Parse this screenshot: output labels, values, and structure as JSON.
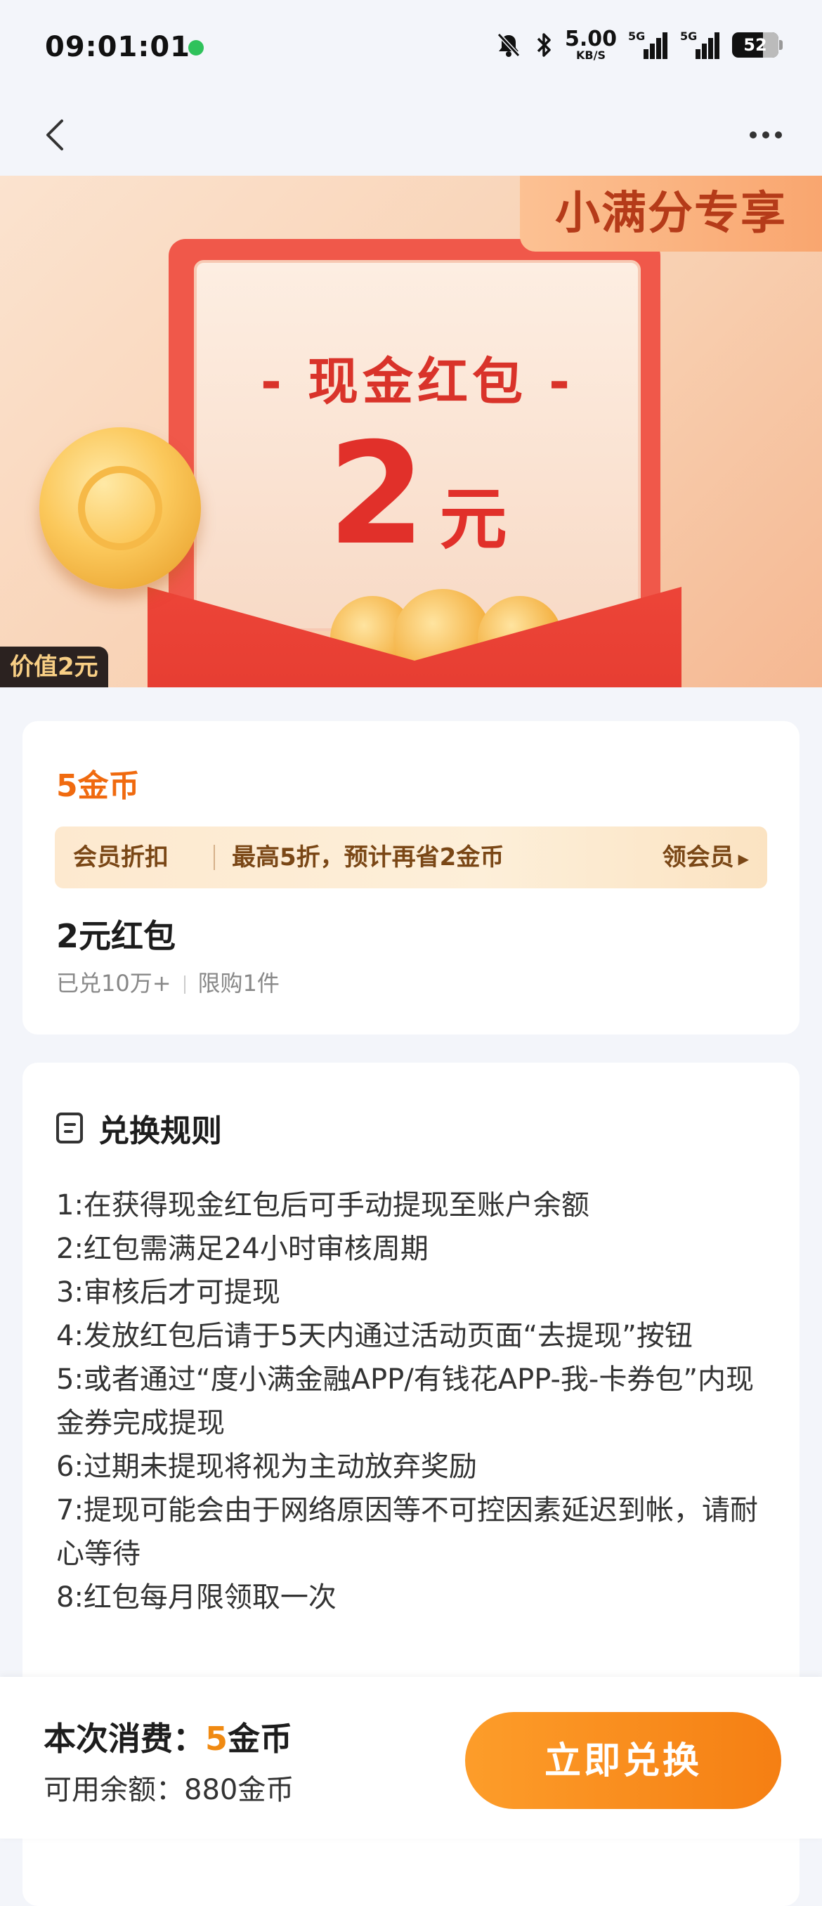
{
  "status_bar": {
    "time": "09:01:01",
    "speed_value": "5.00",
    "speed_unit": "KB/S",
    "signal1_label": "5G",
    "signal2_label": "5G",
    "battery": "52"
  },
  "banner": {
    "exclusive_tag": "小满分专享",
    "title": "- 现金红包 -",
    "amount": "2",
    "unit": "元",
    "value_badge": "价值2元"
  },
  "product": {
    "price": "5金币",
    "member_label": "会员折扣",
    "member_desc": "最高5折，预计再省2金币",
    "member_action": "领会员",
    "name": "2元红包",
    "sold": "已兑10万+",
    "limit": "限购1件"
  },
  "rules": {
    "title": "兑换规则",
    "items": [
      "1:在获得现金红包后可手动提现至账户余额",
      "2:红包需满足24小时审核周期",
      "3:审核后才可提现",
      "4:发放红包后请于5天内通过活动页面“去提现”按钮",
      "5:或者通过“度小满金融APP/有钱花APP-我-卡券包”内现金券完成提现",
      "6:过期未提现将视为主动放弃奖励",
      "7:提现可能会由于网络原因等不可控因素延迟到帐，请耐心等待",
      "8:红包每月限领取一次"
    ]
  },
  "bottom": {
    "cost_label": "本次消费：",
    "cost_num": "5",
    "cost_unit": "金币",
    "balance": "可用余额：880金币",
    "redeem_button": "立即兑换"
  },
  "colors": {
    "accent": "#f08a12",
    "price": "#f06a0f",
    "envelope": "#f0584a",
    "button": "#f57f13"
  }
}
